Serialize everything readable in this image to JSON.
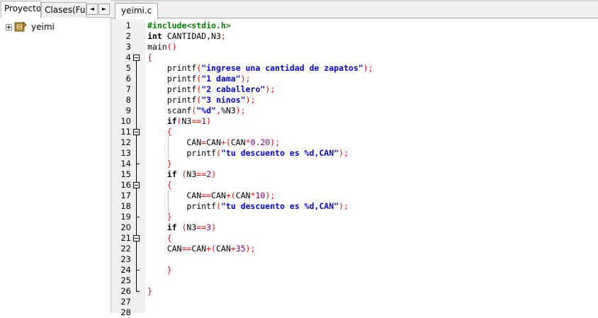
{
  "left_panel": {
    "tabs": [
      "Proyecto",
      "Clases(Fun"
    ],
    "scroll_left": "◄",
    "scroll_right": "►",
    "tree": [
      {
        "label": "yeimi"
      }
    ]
  },
  "editor": {
    "tab_label": "yeimi.c",
    "line_numbers": [
      "1",
      "2",
      "3",
      "4",
      "5",
      "6",
      "7",
      "8",
      "9",
      "10",
      "11",
      "12",
      "13",
      "14",
      "15",
      "16",
      "17",
      "18",
      "19",
      "20",
      "21",
      "22",
      "23",
      "24",
      "25",
      "26",
      "27",
      "28"
    ],
    "lines": [
      [
        [
          "pp",
          "#include<stdio.h>"
        ]
      ],
      [
        [
          "kw",
          "int"
        ],
        [
          "id",
          " CANTIDAD,N3"
        ],
        [
          "sym",
          ";"
        ]
      ],
      [
        [
          "id",
          "main"
        ],
        [
          "sym",
          "()"
        ]
      ],
      [
        [
          "sym",
          "{"
        ]
      ],
      [
        [
          "id",
          "    printf"
        ],
        [
          "sym",
          "("
        ],
        [
          "str",
          "\"ingrese una cantidad de zapatos\""
        ],
        [
          "sym",
          ");"
        ]
      ],
      [
        [
          "id",
          "    printf"
        ],
        [
          "sym",
          "("
        ],
        [
          "str",
          "\"1 dama\""
        ],
        [
          "sym",
          ");"
        ]
      ],
      [
        [
          "id",
          "    printf"
        ],
        [
          "sym",
          "("
        ],
        [
          "str",
          "\"2 caballero\""
        ],
        [
          "sym",
          ");"
        ]
      ],
      [
        [
          "id",
          "    printf"
        ],
        [
          "sym",
          "("
        ],
        [
          "str",
          "\"3 ninos\""
        ],
        [
          "sym",
          ");"
        ]
      ],
      [
        [
          "id",
          "    scanf"
        ],
        [
          "sym",
          "("
        ],
        [
          "str",
          "\"%d\""
        ],
        [
          "sym",
          ","
        ],
        [
          "id",
          "%N3"
        ],
        [
          "sym",
          ");"
        ]
      ],
      [
        [
          "kw",
          "    if"
        ],
        [
          "sym",
          "("
        ],
        [
          "id",
          "N3"
        ],
        [
          "sym",
          "=="
        ],
        [
          "num",
          "1"
        ],
        [
          "sym",
          ")"
        ]
      ],
      [
        [
          "sym",
          "    {"
        ]
      ],
      [
        [
          "id",
          "        CAN"
        ],
        [
          "sym",
          "="
        ],
        [
          "id",
          "CAN"
        ],
        [
          "sym",
          "+("
        ],
        [
          "id",
          "CAN"
        ],
        [
          "sym",
          "*"
        ],
        [
          "num",
          "0.20"
        ],
        [
          "sym",
          ");"
        ]
      ],
      [
        [
          "id",
          "        printf"
        ],
        [
          "sym",
          "("
        ],
        [
          "str",
          "\"tu descuento es %d,CAN\""
        ],
        [
          "sym",
          ");"
        ]
      ],
      [
        [
          "sym",
          "    }"
        ]
      ],
      [
        [
          "kw",
          "    if"
        ],
        [
          "id",
          " "
        ],
        [
          "sym",
          "("
        ],
        [
          "id",
          "N3"
        ],
        [
          "sym",
          "=="
        ],
        [
          "num",
          "2"
        ],
        [
          "sym",
          ")"
        ]
      ],
      [
        [
          "sym",
          "    {"
        ]
      ],
      [
        [
          "id",
          "        CAN"
        ],
        [
          "sym",
          "=="
        ],
        [
          "id",
          "CAN"
        ],
        [
          "sym",
          "+("
        ],
        [
          "id",
          "CAN"
        ],
        [
          "sym",
          "*"
        ],
        [
          "num",
          "10"
        ],
        [
          "sym",
          ");"
        ]
      ],
      [
        [
          "id",
          "        printf"
        ],
        [
          "sym",
          "("
        ],
        [
          "str",
          "\"tu descuento es %d,CAN\""
        ],
        [
          "sym",
          ");"
        ]
      ],
      [
        [
          "sym",
          "    }"
        ]
      ],
      [
        [
          "kw",
          "    if"
        ],
        [
          "id",
          " "
        ],
        [
          "sym",
          "("
        ],
        [
          "id",
          "N3"
        ],
        [
          "sym",
          "=="
        ],
        [
          "num",
          "3"
        ],
        [
          "sym",
          ")"
        ]
      ],
      [
        [
          "sym",
          "    {"
        ]
      ],
      [
        [
          "id",
          "    CAN"
        ],
        [
          "sym",
          "=="
        ],
        [
          "id",
          "CAN"
        ],
        [
          "sym",
          "+("
        ],
        [
          "id",
          "CAN"
        ],
        [
          "sym",
          "+"
        ],
        [
          "num",
          "35"
        ],
        [
          "sym",
          ");"
        ]
      ],
      [],
      [
        [
          "sym",
          "    }"
        ]
      ],
      [],
      [
        [
          "sym",
          "}"
        ]
      ],
      [],
      []
    ],
    "fold_open_lines": [
      4,
      11,
      16,
      21
    ],
    "colors": {
      "preprocessor": "#008000",
      "string": "#0000ff",
      "symbol": "#ff0000",
      "number": "#800080",
      "keyword": "#000000"
    }
  }
}
